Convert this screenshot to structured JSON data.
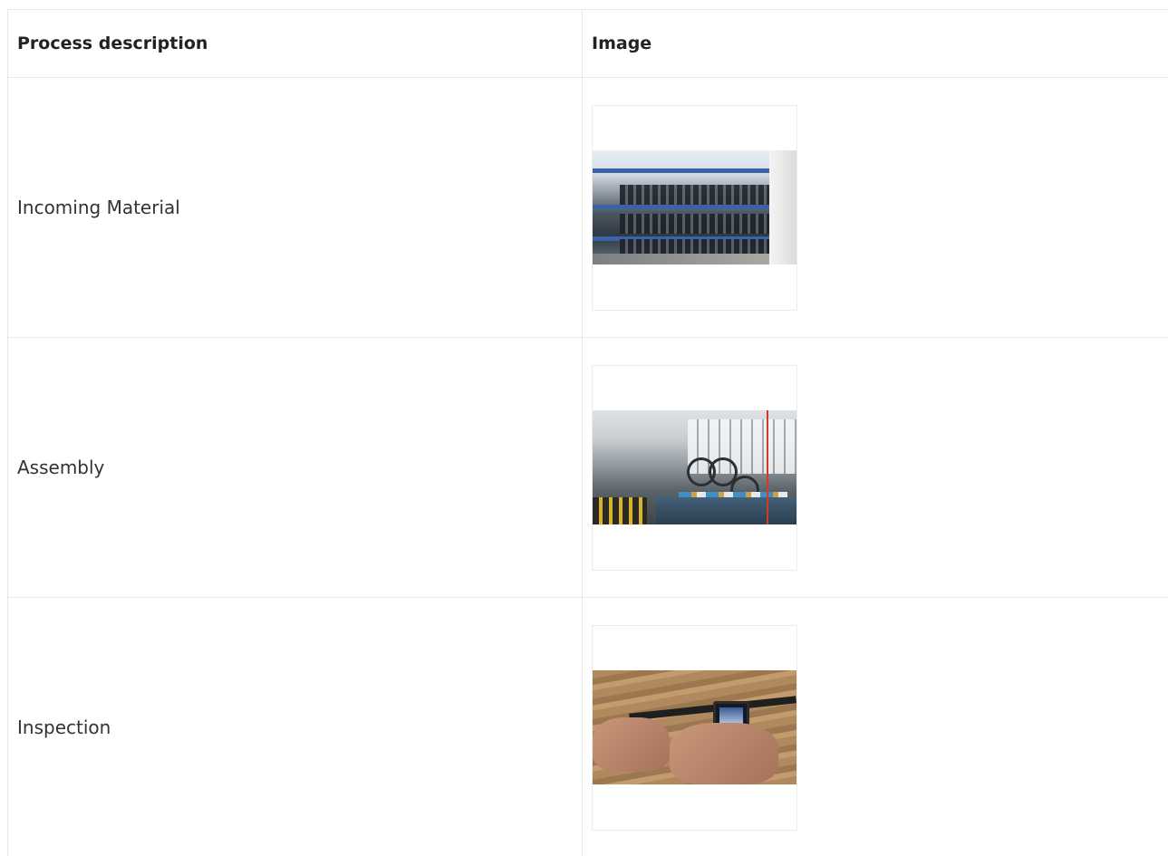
{
  "table": {
    "headers": [
      "Process description",
      "Image"
    ],
    "rows": [
      {
        "description": "Incoming Material",
        "image_alt": "Incoming Material"
      },
      {
        "description": "Assembly",
        "image_alt": "Assembly"
      },
      {
        "description": "Inspection",
        "image_alt": "Inspection"
      }
    ]
  }
}
